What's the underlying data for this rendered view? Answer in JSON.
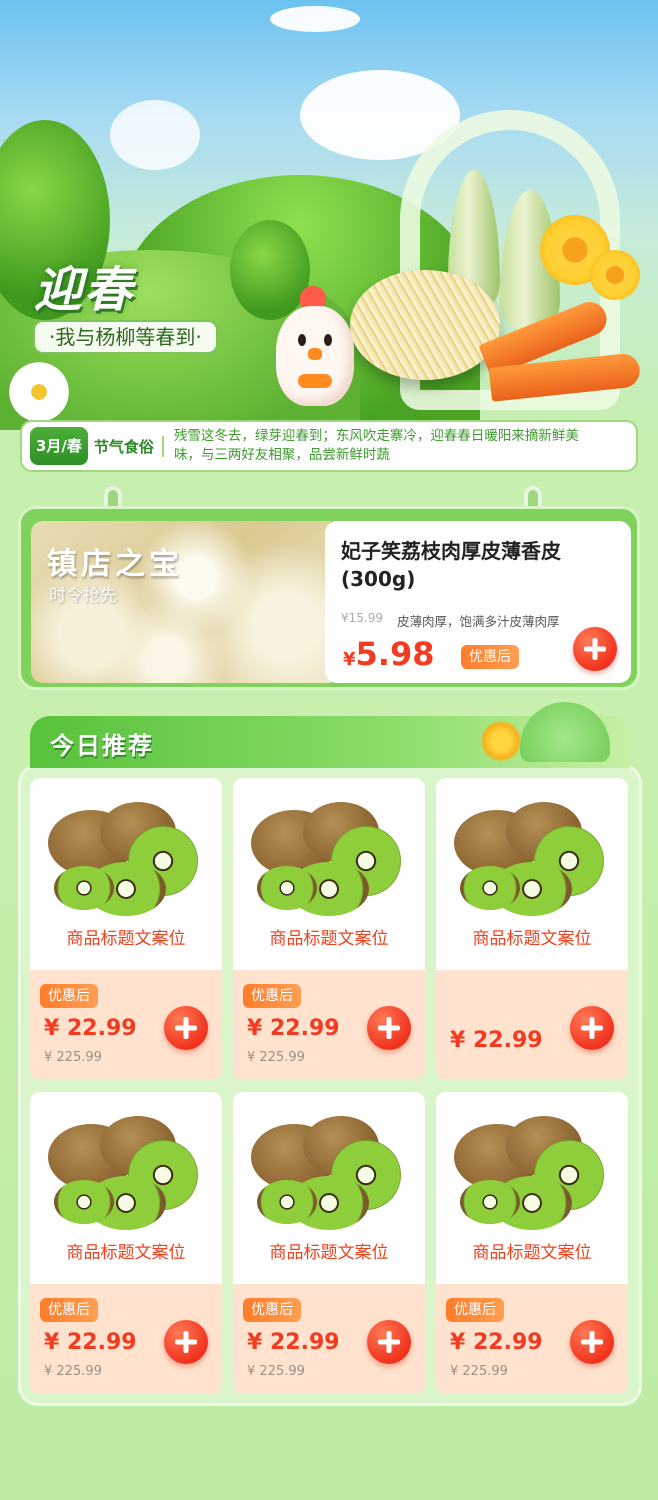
{
  "hero": {
    "title": "迎春",
    "subtitle": "·我与杨柳等春到·"
  },
  "solar_term": {
    "badge": "3月/春",
    "label": "节气食俗",
    "text": "残雪这冬去，绿芽迎春到；东风吹走寨冷，迎春春日暖阳来摘新鲜美味，与三两好友相聚，品尝新鲜时蔬"
  },
  "featured": {
    "tag": "镇店之宝",
    "tag_sub": "时令抢先",
    "title": "妃子笑荔枝肉厚皮薄香皮(300g)",
    "original_price": "¥15.99",
    "description": "皮薄肉厚，饱满多汁皮薄肉厚",
    "price_symbol": "¥",
    "price": "5.98",
    "discount_label": "优惠后"
  },
  "recommend": {
    "title": "今日推荐",
    "products": [
      {
        "name": "商品标题文案位",
        "discount_label": "优惠后",
        "price": "¥ 22.99",
        "original_price": "¥ 225.99"
      },
      {
        "name": "商品标题文案位",
        "discount_label": "优惠后",
        "price": "¥ 22.99",
        "original_price": "¥ 225.99"
      },
      {
        "name": "商品标题文案位",
        "discount_label": "",
        "price": "¥ 22.99",
        "original_price": ""
      },
      {
        "name": "商品标题文案位",
        "discount_label": "优惠后",
        "price": "¥ 22.99",
        "original_price": "¥ 225.99"
      },
      {
        "name": "商品标题文案位",
        "discount_label": "优惠后",
        "price": "¥ 22.99",
        "original_price": "¥ 225.99"
      },
      {
        "name": "商品标题文案位",
        "discount_label": "优惠后",
        "price": "¥ 22.99",
        "original_price": "¥ 225.99"
      }
    ]
  },
  "icons": {
    "add": "plus-icon",
    "mascot": "chicken-mascot"
  },
  "colors": {
    "brand_green": "#4caf3a",
    "price_red": "#f23b21",
    "discount_orange": "#ff7c2a"
  }
}
